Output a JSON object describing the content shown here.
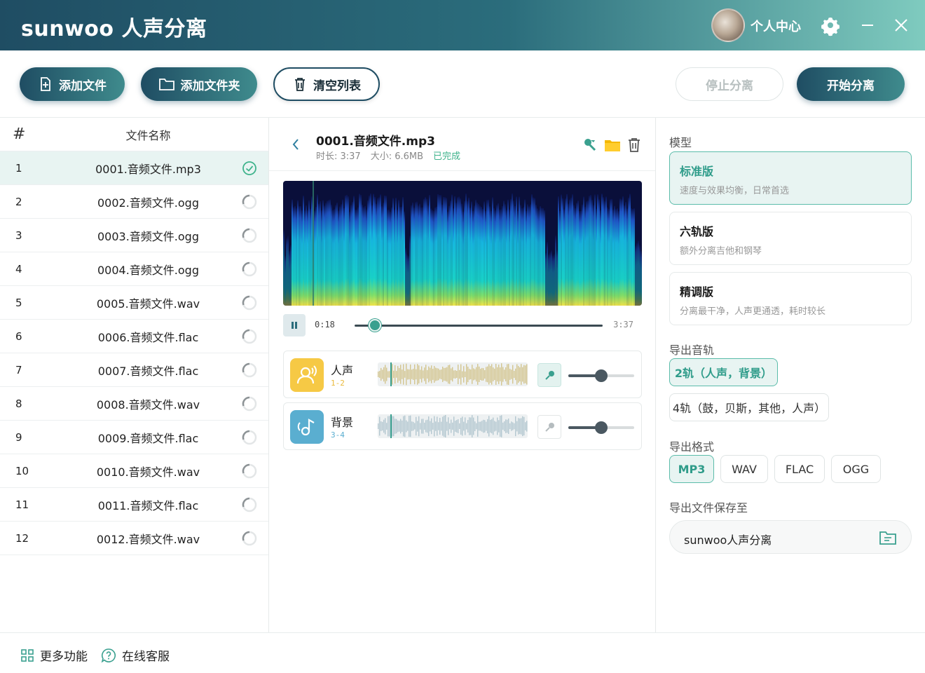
{
  "app": {
    "logo": "sunwoo 人声分离",
    "user_center": "个人中心"
  },
  "toolbar": {
    "add_file": "添加文件",
    "add_folder": "添加文件夹",
    "clear_list": "清空列表",
    "stop_split": "停止分离",
    "start_split": "开始分离"
  },
  "filelist": {
    "header_num": "#",
    "header_name": "文件名称",
    "rows": [
      {
        "num": "1",
        "name": "0001.音频文件.mp3",
        "status": "done"
      },
      {
        "num": "2",
        "name": "0002.音频文件.ogg",
        "status": "pending"
      },
      {
        "num": "3",
        "name": "0003.音频文件.ogg",
        "status": "pending"
      },
      {
        "num": "4",
        "name": "0004.音频文件.ogg",
        "status": "pending"
      },
      {
        "num": "5",
        "name": "0005.音频文件.wav",
        "status": "pending"
      },
      {
        "num": "6",
        "name": "0006.音频文件.flac",
        "status": "pending"
      },
      {
        "num": "7",
        "name": "0007.音频文件.flac",
        "status": "pending"
      },
      {
        "num": "8",
        "name": "0008.音频文件.wav",
        "status": "pending"
      },
      {
        "num": "9",
        "name": "0009.音频文件.flac",
        "status": "pending"
      },
      {
        "num": "10",
        "name": "0010.音频文件.wav",
        "status": "pending"
      },
      {
        "num": "11",
        "name": "0011.音频文件.flac",
        "status": "pending"
      },
      {
        "num": "12",
        "name": "0012.音频文件.wav",
        "status": "pending"
      }
    ]
  },
  "detail": {
    "title": "0001.音频文件.mp3",
    "duration": "时长: 3:37",
    "size": "大小: 6.6MB",
    "status": "已完成",
    "current_time": "0:18",
    "total_time": "3:37",
    "progress": 0.083,
    "stems": [
      {
        "name": "人声",
        "channels": "1-2",
        "icon": "vocal-icon",
        "color": "#f6c945",
        "volume": 0.5
      },
      {
        "name": "背景",
        "channels": "3-4",
        "icon": "music-note-icon",
        "color": "#5aaed0",
        "volume": 0.5
      }
    ]
  },
  "settings": {
    "model_title": "模型",
    "models": [
      {
        "title": "标准版",
        "desc": "速度与效果均衡，日常首选",
        "selected": true
      },
      {
        "title": "六轨版",
        "desc": "额外分离吉他和钢琴",
        "selected": false
      },
      {
        "title": "精调版",
        "desc": "分离最干净，人声更通透，耗时较长",
        "selected": false
      }
    ],
    "tracks_title": "导出音轨",
    "tracks": [
      "2轨（人声，背景）",
      "4轨（鼓，贝斯，其他，人声）"
    ],
    "format_title": "导出格式",
    "formats": [
      "MP3",
      "WAV",
      "FLAC",
      "OGG"
    ],
    "save_title": "导出文件保存至",
    "save_path": "sunwoo人声分离"
  },
  "footer": {
    "more_features": "更多功能",
    "online_service": "在线客服"
  },
  "colors": {
    "brand_dark": "#1f4d63",
    "brand_teal": "#3f8b8d",
    "accent": "#2f9c8a",
    "done": "#3fb38c"
  }
}
